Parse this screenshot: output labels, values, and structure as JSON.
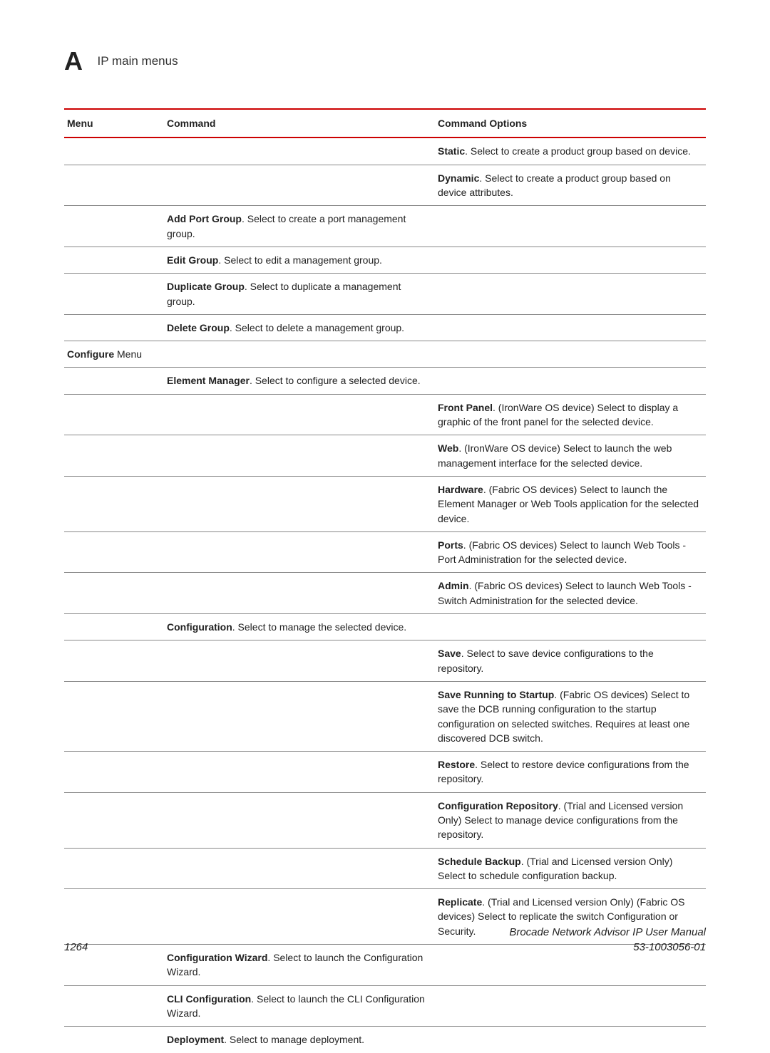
{
  "heading": {
    "letter": "A",
    "title": "IP main menus"
  },
  "table_head": {
    "menu": "Menu",
    "command": "Command",
    "options": "Command Options"
  },
  "rows": [
    {
      "menu": "",
      "cmd_b": "",
      "cmd": "",
      "opt_b": "Static",
      "opt": ". Select to create a product group based on device."
    },
    {
      "menu": "",
      "cmd_b": "",
      "cmd": "",
      "opt_b": "Dynamic",
      "opt": ". Select to create a product group based on device attributes."
    },
    {
      "menu": "",
      "cmd_b": "Add Port Group",
      "cmd": ". Select to create a port management group.",
      "opt_b": "",
      "opt": ""
    },
    {
      "menu": "",
      "cmd_b": "Edit Group",
      "cmd": ". Select to edit a management group.",
      "opt_b": "",
      "opt": ""
    },
    {
      "menu": "",
      "cmd_b": "Duplicate Group",
      "cmd": ". Select to duplicate a management group.",
      "opt_b": "",
      "opt": ""
    },
    {
      "menu": "",
      "cmd_b": "Delete Group",
      "cmd": ". Select to delete a management group.",
      "opt_b": "",
      "opt": ""
    },
    {
      "menu_b": "Configure",
      "menu": " Menu",
      "cmd_b": "",
      "cmd": "",
      "opt_b": "",
      "opt": ""
    },
    {
      "menu": "",
      "cmd_b": "Element Manager",
      "cmd": ". Select to configure a selected device.",
      "opt_b": "",
      "opt": ""
    },
    {
      "menu": "",
      "cmd_b": "",
      "cmd": "",
      "opt_b": "Front Panel",
      "opt": ". (IronWare OS device) Select to display a graphic of the front panel for the selected device."
    },
    {
      "menu": "",
      "cmd_b": "",
      "cmd": "",
      "opt_b": "Web",
      "opt": ". (IronWare OS device) Select to launch the web management interface for the selected device."
    },
    {
      "menu": "",
      "cmd_b": "",
      "cmd": "",
      "opt_b": "Hardware",
      "opt": ". (Fabric OS devices) Select to launch the Element Manager or Web Tools application for the selected device."
    },
    {
      "menu": "",
      "cmd_b": "",
      "cmd": "",
      "opt_b": "Ports",
      "opt": ". (Fabric OS devices) Select to launch Web Tools - Port Administration for the selected device."
    },
    {
      "menu": "",
      "cmd_b": "",
      "cmd": "",
      "opt_b": "Admin",
      "opt": ". (Fabric OS devices) Select to launch Web Tools - Switch Administration for the selected device."
    },
    {
      "menu": "",
      "cmd_b": "Configuration",
      "cmd": ". Select to manage the selected device.",
      "opt_b": "",
      "opt": ""
    },
    {
      "menu": "",
      "cmd_b": "",
      "cmd": "",
      "opt_b": "Save",
      "opt": ". Select to save device configurations to the repository."
    },
    {
      "menu": "",
      "cmd_b": "",
      "cmd": "",
      "opt_b": "Save Running to Startup",
      "opt": ". (Fabric OS devices) Select to save the DCB running configuration to the startup configuration on selected switches. Requires at least one discovered DCB switch."
    },
    {
      "menu": "",
      "cmd_b": "",
      "cmd": "",
      "opt_b": "Restore",
      "opt": ". Select to restore device configurations from the repository."
    },
    {
      "menu": "",
      "cmd_b": "",
      "cmd": "",
      "opt_b": "Configuration Repository",
      "opt": ". (Trial and Licensed version Only) Select to manage device configurations from the repository."
    },
    {
      "menu": "",
      "cmd_b": "",
      "cmd": "",
      "opt_b": "Schedule Backup",
      "opt": ". (Trial and Licensed version Only) Select to schedule configuration backup."
    },
    {
      "menu": "",
      "cmd_b": "",
      "cmd": "",
      "opt_b": "Replicate",
      "opt": ". (Trial and Licensed version Only) (Fabric OS devices) Select to replicate the switch Configuration or Security."
    },
    {
      "menu": "",
      "cmd_b": "Configuration Wizard",
      "cmd": ". Select to launch the Configuration Wizard.",
      "opt_b": "",
      "opt": ""
    },
    {
      "menu": "",
      "cmd_b": "CLI Configuration",
      "cmd": ". Select to launch the CLI Configuration Wizard.",
      "opt_b": "",
      "opt": ""
    },
    {
      "menu": "",
      "cmd_b": "Deployment",
      "cmd": ". Select to manage deployment.",
      "opt_b": "",
      "opt": "",
      "noborder": true
    }
  ],
  "footer": {
    "page": "1264",
    "book": "Brocade Network Advisor IP User Manual",
    "doc": "53-1003056-01"
  }
}
